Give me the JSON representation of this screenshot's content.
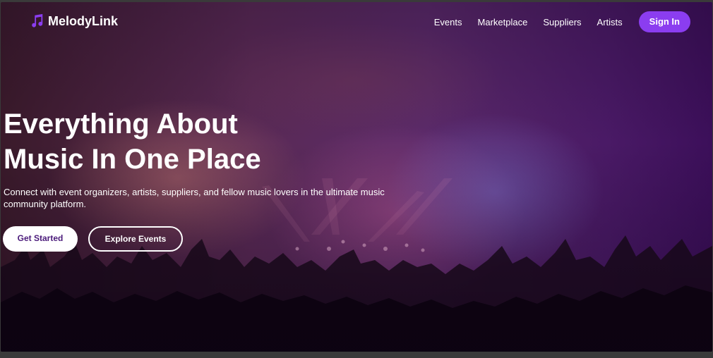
{
  "brand": {
    "name": "MelodyLink",
    "icon": "music-note-icon",
    "icon_color": "#8b3df0"
  },
  "nav": {
    "links": [
      "Events",
      "Marketplace",
      "Suppliers",
      "Artists"
    ],
    "signin_label": "Sign In",
    "signin_color": "#8b3df0"
  },
  "hero": {
    "headline_line1": "Everything About",
    "headline_line2": "Music In One Place",
    "subtitle": "Connect with event organizers, artists, suppliers, and fellow music lovers in the ultimate music community platform.",
    "primary_cta": "Get Started",
    "secondary_cta": "Explore Events",
    "background": "concert-crowd-image"
  }
}
